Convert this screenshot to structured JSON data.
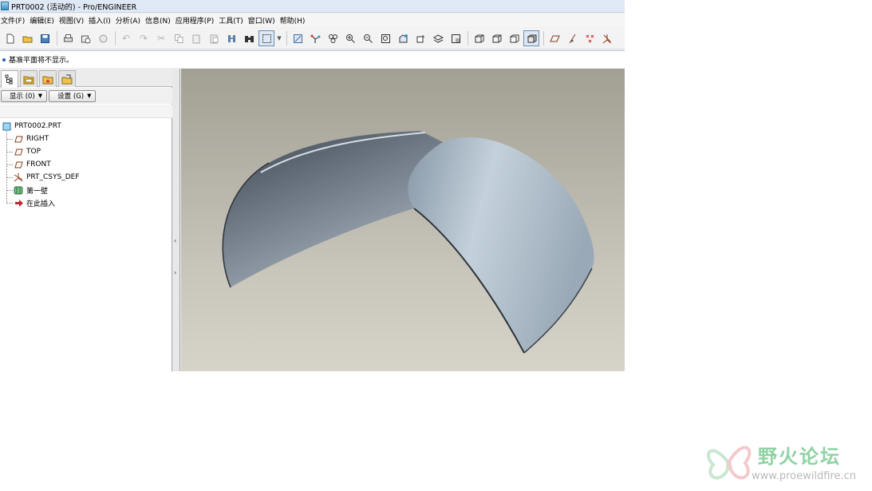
{
  "window": {
    "title": "PRT0002 (活动的) - Pro/ENGINEER"
  },
  "menu": [
    "文件(F)",
    "编辑(E)",
    "视图(V)",
    "插入(I)",
    "分析(A)",
    "信息(N)",
    "应用程序(P)",
    "工具(T)",
    "窗口(W)",
    "帮助(H)"
  ],
  "toolbar": {
    "icons": [
      "new-icon",
      "open-icon",
      "save-icon",
      "print-icon",
      "send-icon",
      "erase-icon",
      "undo-icon",
      "redo-icon",
      "cut-icon",
      "copy-icon",
      "paste-icon",
      "paste-special-icon",
      "regenerate-icon",
      "find-icon",
      "select-box-icon",
      "datum-display-icon",
      "spin-center-icon",
      "orient-icon",
      "zoom-in-icon",
      "zoom-out-icon",
      "refit-icon",
      "reorient-icon",
      "saved-views-icon",
      "layers-icon",
      "view-manager-icon",
      "wireframe-icon",
      "hidden-line-icon",
      "no-hidden-icon",
      "shading-icon",
      "datum-planes-icon",
      "datum-axes-icon",
      "datum-points-icon",
      "coordinate-systems-icon"
    ]
  },
  "message": "基准平面将不显示。",
  "navigator": {
    "filter_buttons": {
      "show": "显示 (0)",
      "settings": "设置 (G)"
    },
    "tree": {
      "root": "PRT0002.PRT",
      "items": [
        {
          "label": "RIGHT",
          "icon": "datum-plane-icon"
        },
        {
          "label": "TOP",
          "icon": "datum-plane-icon"
        },
        {
          "label": "FRONT",
          "icon": "datum-plane-icon"
        },
        {
          "label": "PRT_CSYS_DEF",
          "icon": "csys-icon"
        },
        {
          "label": "第一壁",
          "icon": "wall-feature-icon"
        },
        {
          "label": "在此插入",
          "icon": "insert-here-arrow-icon"
        }
      ]
    }
  },
  "watermark": {
    "title": "野火论坛",
    "url": "www.proewildfire.cn"
  },
  "colors": {
    "model_shade": "#b8c6d2",
    "viewport_top": "#a29f93",
    "viewport_bottom": "#d6d3c8",
    "watermark_green": "#8fd3a3"
  }
}
